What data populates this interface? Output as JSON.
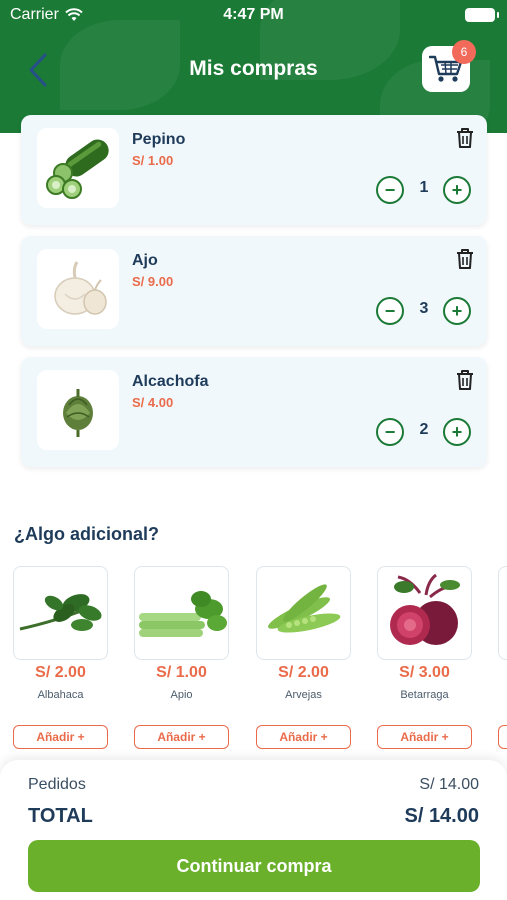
{
  "status": {
    "carrier": "Carrier",
    "time": "4:47 PM"
  },
  "header": {
    "title": "Mis compras",
    "cart_count": "6"
  },
  "cart_items": [
    {
      "name": "Pepino",
      "price": "S/ 1.00",
      "qty": "1"
    },
    {
      "name": "Ajo",
      "price": "S/ 9.00",
      "qty": "3"
    },
    {
      "name": "Alcachofa",
      "price": "S/ 4.00",
      "qty": "2"
    }
  ],
  "extras": {
    "title": "¿Algo adicional?",
    "add_label": "Añadir +",
    "items": [
      {
        "price": "S/ 2.00",
        "name": "Albahaca"
      },
      {
        "price": "S/ 1.00",
        "name": "Apio"
      },
      {
        "price": "S/ 2.00",
        "name": "Arvejas"
      },
      {
        "price": "S/ 3.00",
        "name": "Betarraga"
      }
    ]
  },
  "summary": {
    "orders_label": "Pedidos",
    "orders_value": "S/ 14.00",
    "total_label": "TOTAL",
    "total_value": "S/ 14.00",
    "cta_label": "Continuar compra"
  },
  "colors": {
    "brand_green": "#1a7a36",
    "accent_orange": "#ea6b4a",
    "cta_green": "#6ab02a",
    "badge": "#f26a5a"
  }
}
